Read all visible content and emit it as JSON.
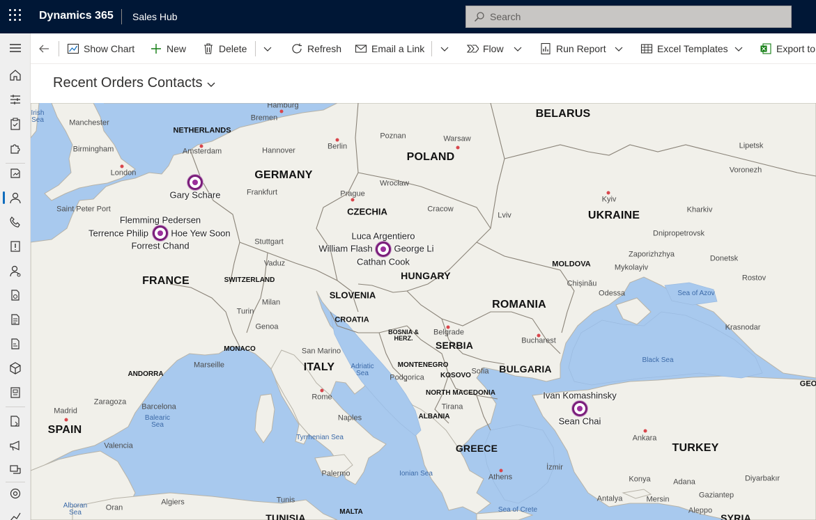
{
  "header": {
    "app_name": "Dynamics 365",
    "app_area": "Sales Hub",
    "search_placeholder": "Search"
  },
  "commands": {
    "show_chart": "Show Chart",
    "new": "New",
    "delete": "Delete",
    "refresh": "Refresh",
    "email_link": "Email a Link",
    "flow": "Flow",
    "run_report": "Run Report",
    "excel_templates": "Excel Templates",
    "export": "Export to"
  },
  "view": {
    "title": "Recent Orders Contacts"
  },
  "colors": {
    "topbar": "#001736",
    "pin": "#7a1d7a",
    "water": "#a8c9ee",
    "land": "#f1f0ea"
  },
  "map": {
    "countries": {
      "belarus": "BELARUS",
      "netherlands": "NETHERLANDS",
      "germany": "GERMANY",
      "poland": "POLAND",
      "czechia": "CZECHIA",
      "ukraine": "UKRAINE",
      "moldova": "MOLDOVA",
      "france": "FRANCE",
      "switzerland": "SWITZERLAND",
      "hungary": "HUNGARY",
      "slovenia": "SLOVENIA",
      "romania": "ROMANIA",
      "croatia": "CROATIA",
      "bosnia": "BOSNIA &\nHERZ.",
      "serbia": "SERBIA",
      "monaco": "MONACO",
      "italy": "ITALY",
      "montenegro": "MONTENEGRO",
      "kosovo": "KOSOVO",
      "bulgaria": "BULGARIA",
      "andorra": "ANDORRA",
      "north_macedonia": "NORTH MACEDONIA",
      "albania": "ALBANIA",
      "spain": "SPAIN",
      "greece": "GREECE",
      "turkey": "TURKEY",
      "tunisia": "TUNISIA",
      "malta": "MALTA",
      "syria": "SYRIA",
      "georgia_partial": "GEO"
    },
    "cities": {
      "hamburg": "Hamburg",
      "manchester": "Manchester",
      "bremen": "Bremen",
      "poznan": "Poznan",
      "birmingham": "Birmingham",
      "amsterdam": "Amsterdam",
      "hannover": "Hannover",
      "berlin": "Berlin",
      "warsaw": "Warsaw",
      "lipetsk": "Lipetsk",
      "london": "London",
      "voronezh": "Voronezh",
      "frankfurt": "Frankfurt",
      "prague": "Prague",
      "wroclaw": "Wrocław",
      "saint_peter_port": "Saint Peter Port",
      "cracow": "Cracow",
      "kyiv": "Kyiv",
      "lviv": "Lviv",
      "kharkiv": "Kharkiv",
      "dnipropetrovsk": "Dnipropetrovsk",
      "stuttgart": "Stuttgart",
      "zaporizhzhya": "Zaporizhzhya",
      "donetsk": "Donetsk",
      "vaduz": "Vaduz",
      "mykolayiv": "Mykolayiv",
      "chisinau": "Chișinău",
      "rostov": "Rostov",
      "milan": "Milan",
      "odessa": "Odessa",
      "turin": "Turin",
      "krasnodar": "Krasnodar",
      "belgrade": "Belgrade",
      "genoa": "Genoa",
      "bucharest": "Bucharest",
      "marseille": "Marseille",
      "san_marino": "San Marino",
      "sofia": "Sofia",
      "podgorica": "Podgorica",
      "zaragoza": "Zaragoza",
      "tirana": "Tirana",
      "barcelona": "Barcelona",
      "rome": "Rome",
      "madrid": "Madrid",
      "naples": "Naples",
      "ankara": "Ankara",
      "valencia": "Valencia",
      "palermo": "Palermo",
      "athens": "Athens",
      "izmir": "İzmir",
      "konya": "Konya",
      "adana": "Adana",
      "diyarbakir": "Diyarbakır",
      "oran": "Oran",
      "algiers": "Algiers",
      "tunis": "Tunis",
      "antalya": "Antalya",
      "mersin": "Mersin",
      "gaziantep": "Gaziantep",
      "aleppo": "Aleppo"
    },
    "seas": {
      "irish_sea": "Irish\nSea",
      "adriatic": "Adriatic\nSea",
      "black_sea": "Black Sea",
      "azov": "Sea of Azov",
      "balearic": "Balearic\nSea",
      "tyrrhenian": "Tyrrhenian Sea",
      "ionian": "Ionian Sea",
      "alboran": "Alboran\nSea",
      "crete": "Sea of Crete"
    },
    "contacts": {
      "gary_schare": "Gary Schare",
      "flemming_pedersen": "Flemming Pedersen",
      "terrence_philip": "Terrence Philip",
      "hoe_yew_soon": "Hoe Yew Soon",
      "forrest_chand": "Forrest Chand",
      "luca_argentiero": "Luca Argentiero",
      "william_flash": "William Flash",
      "george_li": "George Li",
      "cathan_cook": "Cathan Cook",
      "ivan_komashinsky": "Ivan Komashinsky",
      "sean_chai": "Sean Chai"
    }
  }
}
